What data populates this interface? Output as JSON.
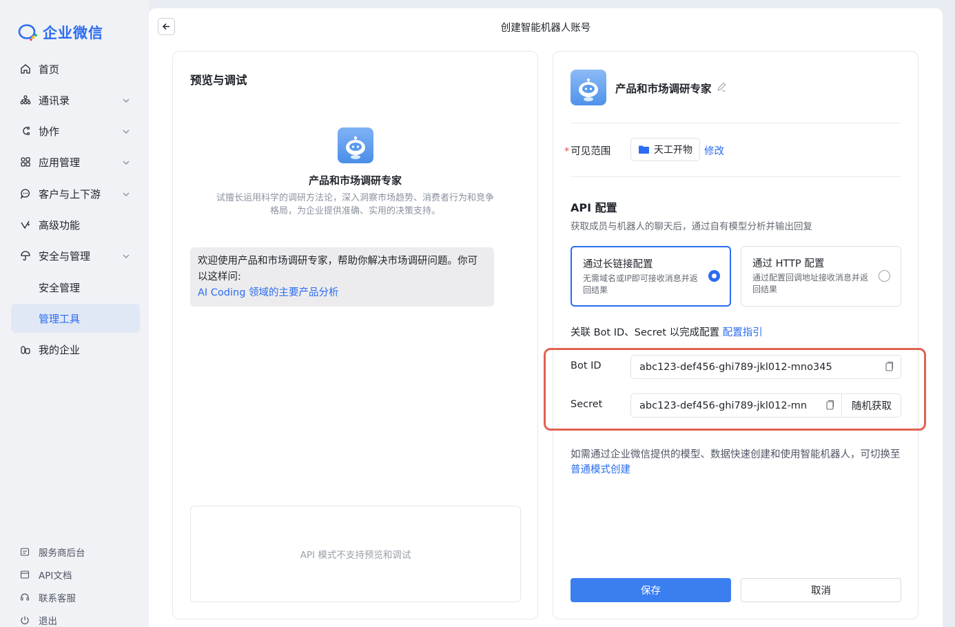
{
  "sidebar": {
    "logo_text": "企业微信",
    "items": [
      {
        "label": "首页",
        "icon": "home-icon"
      },
      {
        "label": "通讯录",
        "icon": "org-chart-icon"
      },
      {
        "label": "协作",
        "icon": "collaboration-icon"
      },
      {
        "label": "应用管理",
        "icon": "apps-grid-icon"
      },
      {
        "label": "客户与上下游",
        "icon": "chat-bubble-icon"
      },
      {
        "label": "高级功能",
        "icon": "sparkle-icon"
      },
      {
        "label": "安全与管理",
        "icon": "umbrella-icon"
      },
      {
        "label": "安全管理"
      },
      {
        "label": "管理工具"
      },
      {
        "label": "我的企业",
        "icon": "building-icon"
      }
    ],
    "footer": [
      {
        "label": "服务商后台",
        "icon": "service-console-icon"
      },
      {
        "label": "API文档",
        "icon": "document-icon"
      },
      {
        "label": "联系客服",
        "icon": "headset-icon"
      },
      {
        "label": "退出",
        "icon": "power-icon"
      }
    ]
  },
  "header": {
    "title": "创建智能机器人账号"
  },
  "preview": {
    "title": "预览与调试",
    "bot_name": "产品和市场调研专家",
    "bot_desc": "试擅长运用科学的调研方法论，深入洞察市场趋势、消费者行为和竞争格局，为企业提供准确、实用的决策支持。",
    "welcome_text": "欢迎使用产品和市场调研专家，帮助你解决市场调研问题。你可以这样问:",
    "example_question": "AI Coding 领域的主要产品分析",
    "api_unsupported": "API 模式不支持预览和调试"
  },
  "config": {
    "bot_name": "产品和市场调研专家",
    "visible_label": "可见范围",
    "required_mark": "*",
    "visible_value": "天工开物",
    "modify_label": "修改",
    "api_title": "API 配置",
    "api_subtitle": "获取成员与机器人的聊天后，通过自有模型分析并输出回复",
    "modes": [
      {
        "title": "通过长链接配置",
        "desc": "无需域名或IP即可接收消息并返回结果",
        "selected": true
      },
      {
        "title": "通过 HTTP 配置",
        "desc": "通过配置回调地址接收消息并返回结果",
        "selected": false
      }
    ],
    "assoc_text": "关联 Bot ID、Secret 以完成配置",
    "assoc_link": "配置指引",
    "bot_id_label": "Bot ID",
    "bot_id_value": "abc123-def456-ghi789-jkl012-mno345",
    "secret_label": "Secret",
    "secret_value": "abc123-def456-ghi789-jkl012-mn",
    "random_button": "随机获取",
    "tip_text": "如需通过企业微信提供的模型、数据快速创建和使用智能机器人，可切换至",
    "tip_link": "普通模式创建",
    "save_button": "保存",
    "cancel_button": "取消"
  },
  "colors": {
    "accent": "#2b6cf0",
    "highlight_border": "#e06150",
    "save_bg": "#3a7ef0"
  }
}
